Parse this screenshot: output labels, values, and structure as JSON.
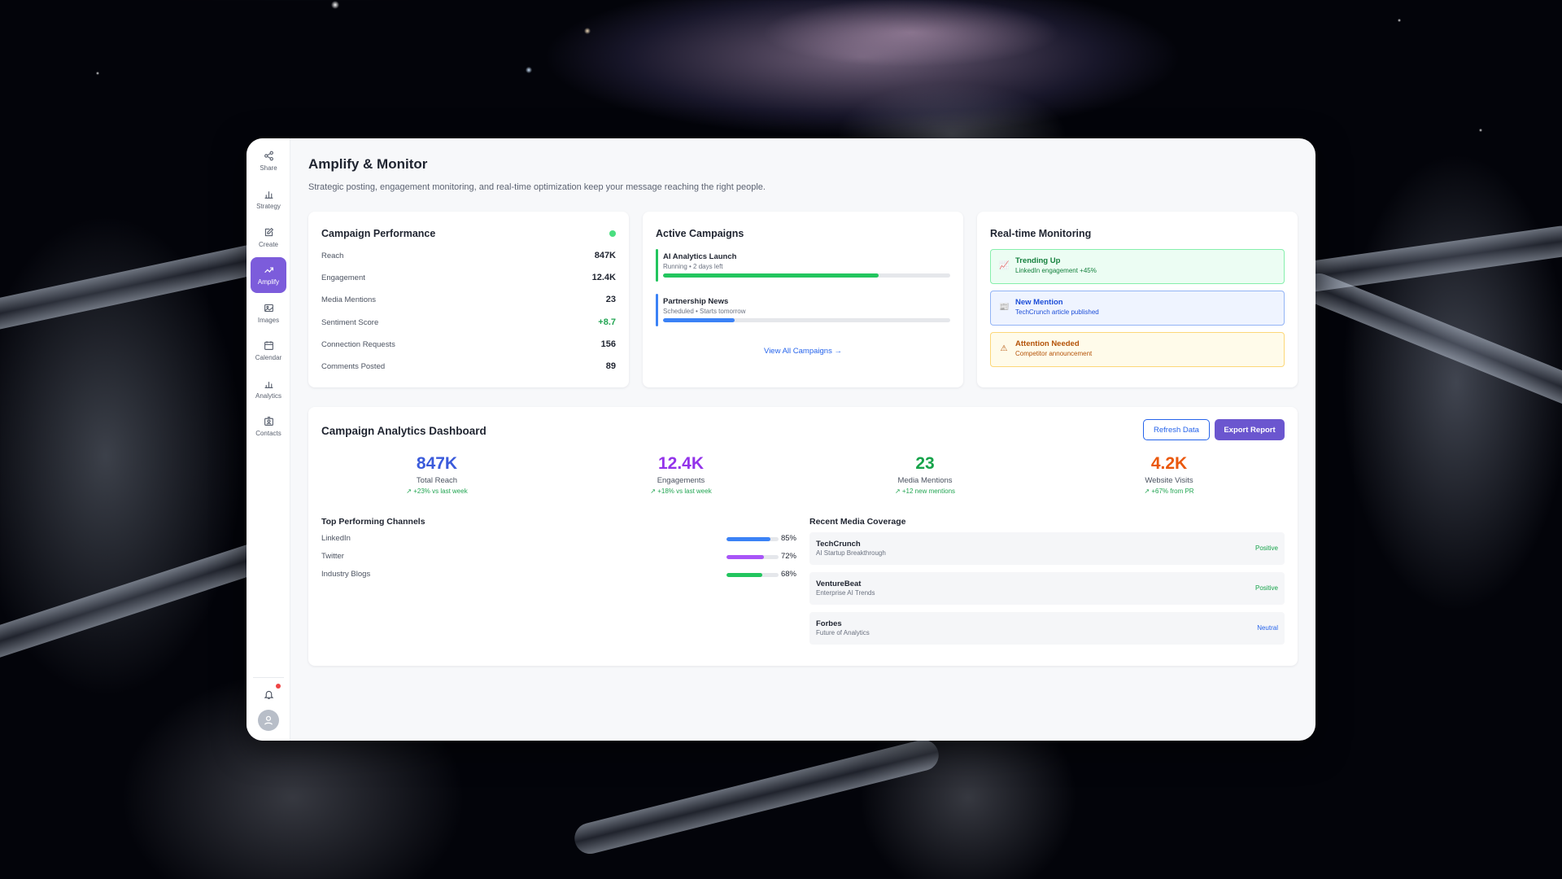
{
  "sidebar": {
    "items": [
      {
        "label": "Share",
        "icon": "share-icon"
      },
      {
        "label": "Strategy",
        "icon": "bar-chart-icon"
      },
      {
        "label": "Create",
        "icon": "edit-icon"
      },
      {
        "label": "Amplify",
        "icon": "trending-up-icon",
        "active": true
      },
      {
        "label": "Images",
        "icon": "image-icon"
      },
      {
        "label": "Calendar",
        "icon": "calendar-icon"
      },
      {
        "label": "Analytics",
        "icon": "analytics-icon"
      },
      {
        "label": "Contacts",
        "icon": "contacts-icon"
      }
    ],
    "has_notification": true
  },
  "page": {
    "title": "Amplify & Monitor",
    "subtitle": "Strategic posting, engagement monitoring, and real-time optimization keep your message reaching the right people."
  },
  "campaign_performance": {
    "title": "Campaign Performance",
    "status_color": "#4ade80",
    "metrics": [
      {
        "label": "Reach",
        "value": "847K"
      },
      {
        "label": "Engagement",
        "value": "12.4K"
      },
      {
        "label": "Media Mentions",
        "value": "23"
      },
      {
        "label": "Sentiment Score",
        "value": "+8.7"
      },
      {
        "label": "Connection Requests",
        "value": "156"
      },
      {
        "label": "Comments Posted",
        "value": "89"
      }
    ]
  },
  "active_campaigns": {
    "title": "Active Campaigns",
    "campaigns": [
      {
        "name": "AI Analytics Launch",
        "status": "Running • 2 days left",
        "progress": 0.75,
        "color": "#22c55e"
      },
      {
        "name": "Partnership News",
        "status": "Scheduled • Starts tomorrow",
        "progress": 0.25,
        "color": "#3b82f6"
      }
    ],
    "view_all": "View All Campaigns →"
  },
  "monitoring": {
    "title": "Real-time Monitoring",
    "alerts": [
      {
        "title": "Trending Up",
        "sub": "LinkedIn engagement +45%",
        "icon": "trend-chart-icon",
        "bg": "#ecfdf3",
        "border": "#86efac",
        "color": "#15803d"
      },
      {
        "title": "New Mention",
        "sub": "TechCrunch article published",
        "icon": "newspaper-icon",
        "bg": "#eff4ff",
        "border": "#93b4f5",
        "color": "#1d4ed8"
      },
      {
        "title": "Attention Needed",
        "sub": "Competitor announcement",
        "icon": "warning-icon",
        "bg": "#fffbea",
        "border": "#fcd778",
        "color": "#b45309"
      }
    ]
  },
  "dashboard": {
    "title": "Campaign Analytics Dashboard",
    "refresh_label": "Refresh Data",
    "export_label": "Export Report",
    "stats": [
      {
        "value": "847K",
        "label": "Total Reach",
        "change": "↗ +23% vs last week",
        "color": "#3b5bdb"
      },
      {
        "value": "12.4K",
        "label": "Engagements",
        "change": "↗ +18% vs last week",
        "color": "#9333ea"
      },
      {
        "value": "23",
        "label": "Media Mentions",
        "change": "↗ +12 new mentions",
        "color": "#16a34a"
      },
      {
        "value": "4.2K",
        "label": "Website Visits",
        "change": "↗ +67% from PR",
        "color": "#ea580c"
      }
    ],
    "channels_title": "Top Performing Channels",
    "channels": [
      {
        "name": "LinkedIn",
        "value": 0.85,
        "label": "85%",
        "color": "#3b82f6"
      },
      {
        "name": "Twitter",
        "value": 0.72,
        "label": "72%",
        "color": "#a855f7"
      },
      {
        "name": "Industry Blogs",
        "value": 0.68,
        "label": "68%",
        "color": "#22c55e"
      }
    ],
    "coverage_title": "Recent Media Coverage",
    "coverage": [
      {
        "outlet": "TechCrunch",
        "headline": "AI Startup Breakthrough",
        "sentiment": "Positive",
        "color": "#16a34a"
      },
      {
        "outlet": "VentureBeat",
        "headline": "Enterprise AI Trends",
        "sentiment": "Positive",
        "color": "#16a34a"
      },
      {
        "outlet": "Forbes",
        "headline": "Future of Analytics",
        "sentiment": "Neutral",
        "color": "#2563eb"
      }
    ]
  }
}
